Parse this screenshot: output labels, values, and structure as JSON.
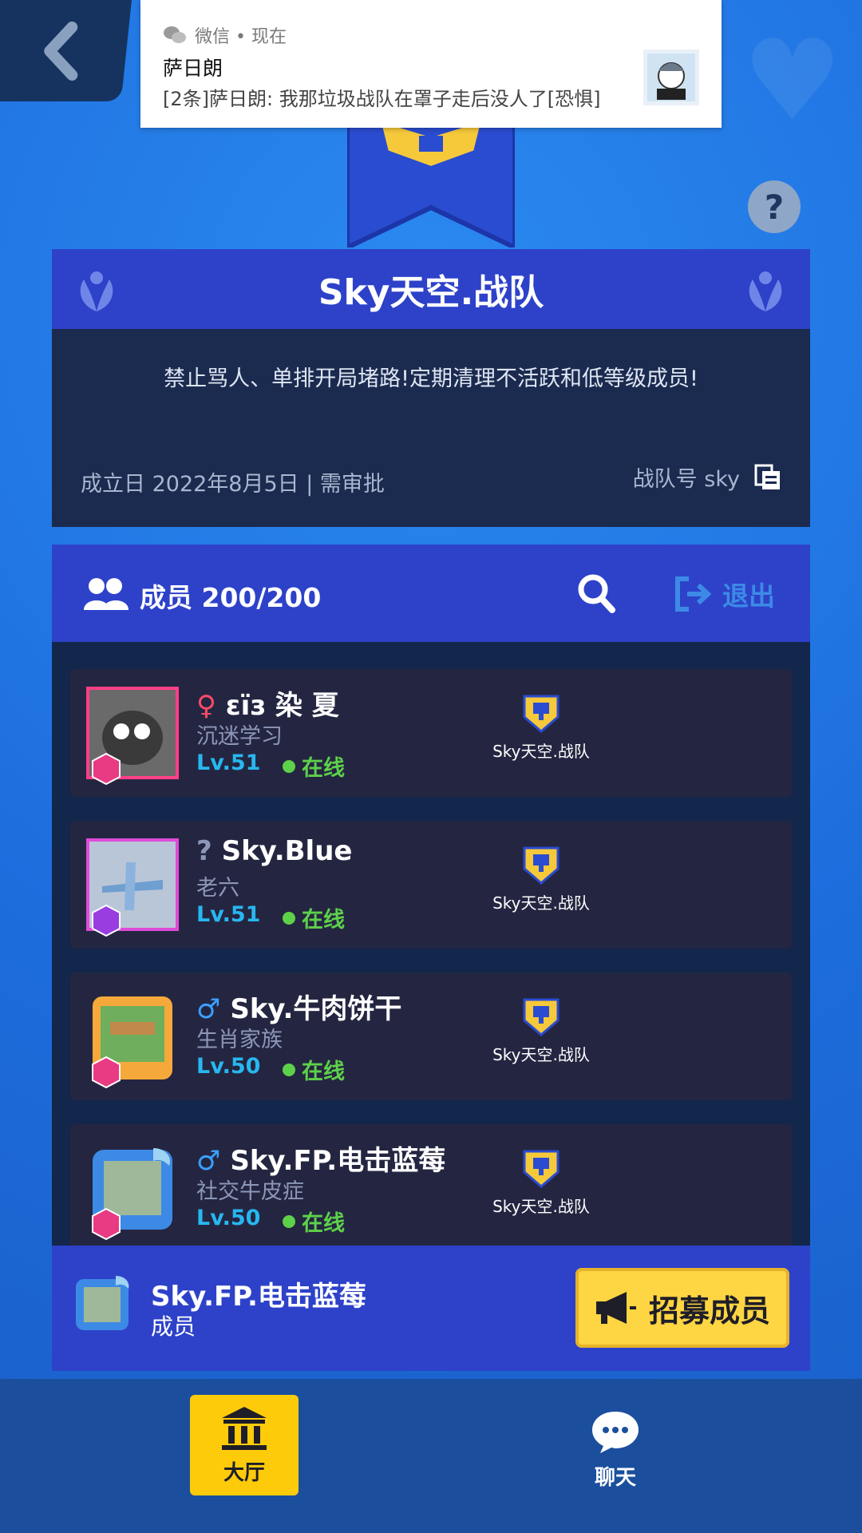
{
  "notification": {
    "app": "微信 • 现在",
    "title": "萨日朗",
    "body": "[2条]萨日朗: 我那垃圾战队在罩子走后没人了[恐惧]"
  },
  "team": {
    "name": "Sky天空.战队",
    "motto": "禁止骂人、单排开局堵路!定期清理不活跃和低等级成员!",
    "meta": "成立日 2022年8月5日 | 需审批",
    "id_label": "战队号 sky"
  },
  "members_header": {
    "count_label": "成员 200/200",
    "exit_label": "退出"
  },
  "members": [
    {
      "gender": "♀",
      "name": "εїз 染 夏",
      "title": "沉迷学习",
      "level": "Lv.51",
      "status": "在线",
      "team": "Sky天空.战队"
    },
    {
      "gender": "?",
      "name": "Sky.Blue",
      "title": "老六",
      "level": "Lv.51",
      "status": "在线",
      "team": "Sky天空.战队"
    },
    {
      "gender": "♂",
      "name": "Sky.牛肉饼干",
      "title": "生肖家族",
      "level": "Lv.50",
      "status": "在线",
      "team": "Sky天空.战队"
    },
    {
      "gender": "♂",
      "name": "Sky.FP.电击蓝莓",
      "title": "社交牛皮症",
      "level": "Lv.50",
      "status": "在线",
      "team": "Sky天空.战队"
    }
  ],
  "self": {
    "name": "Sky.FP.电击蓝莓",
    "role": "成员",
    "recruit_label": "招募成员"
  },
  "nav": {
    "hall_label": "大厅",
    "chat_label": "聊天"
  },
  "colors": {
    "accent_yellow": "#fed542",
    "panel_blue": "#2d42c9",
    "online_green": "#5ed14a",
    "level_cyan": "#27b7f0"
  }
}
